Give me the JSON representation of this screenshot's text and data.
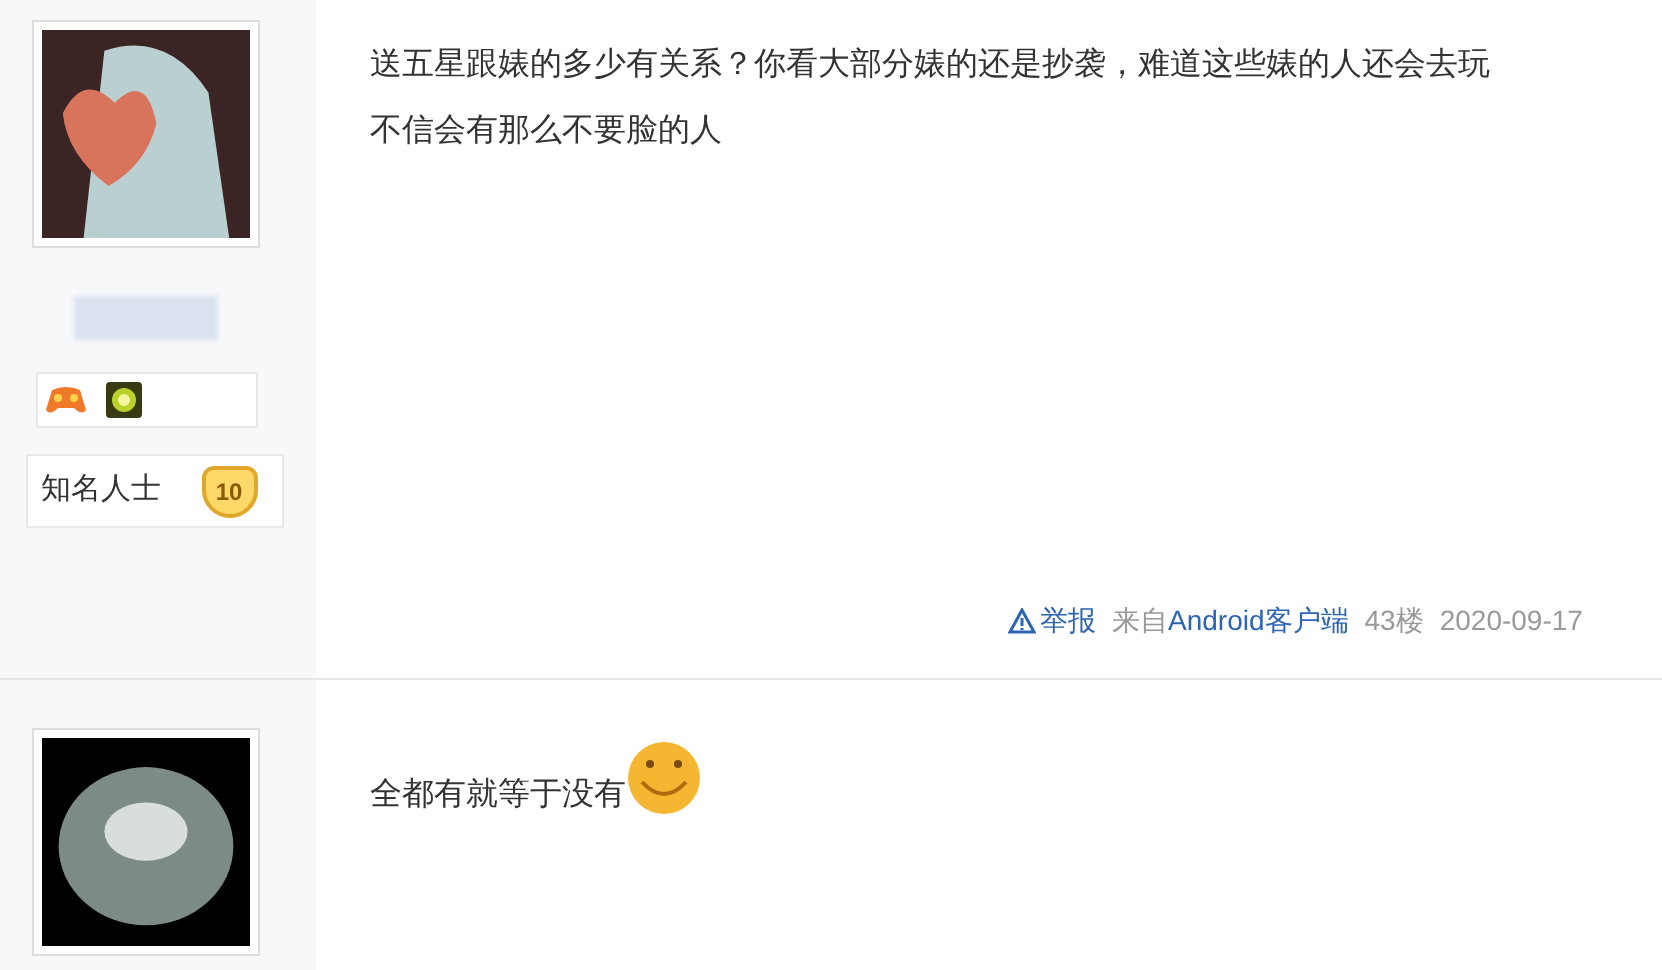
{
  "posts": [
    {
      "author": {
        "badges": [
          {
            "kind": "gamepad"
          },
          {
            "kind": "sun"
          }
        ],
        "title": "知名人士",
        "level": "10"
      },
      "content": "送五星跟婊的多少有关系？你看大部分婊的还是抄袭，难道这些婊的人还会去玩",
      "content_line_2": "不信会有那么不要脸的人",
      "footer": {
        "report": "举报",
        "source_prefix": "来自",
        "client": "Android客户端",
        "floor": "43楼",
        "date": "2020-09-17"
      }
    },
    {
      "content": "全都有就等于没有",
      "emoji": {
        "kind": "smiley"
      }
    }
  ]
}
